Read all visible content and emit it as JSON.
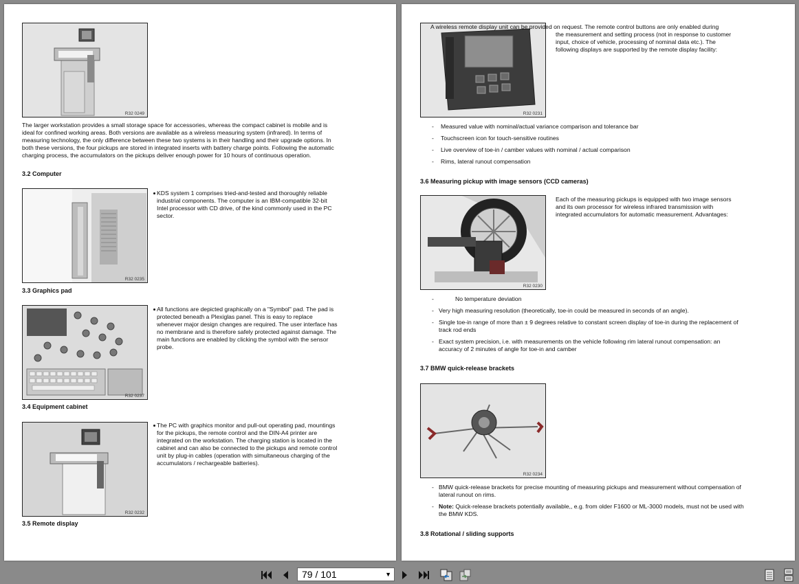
{
  "left": {
    "figures": [
      {
        "code": "R32 0249"
      },
      {
        "code": "R32 0235"
      },
      {
        "code": "R32 0237"
      },
      {
        "code": "R32 0232"
      }
    ],
    "intro_text": "The larger workstation provides a small storage space for accessories, whereas the compact cabinet is mobile and is ideal for confined working areas. Both versions are available as a wireless measuring system (infrared). In terms of measuring technology, the only difference between these two systems is in their handling and their upgrade options. In both these versions, the four pickups are stored in integrated inserts with battery charge points. Following the automatic charging process, the accumulators on the pickups deliver enough power for 10 hours of continuous operation.",
    "h_computer": "3.2 Computer",
    "computer_text": "KDS system 1 comprises tried-and-tested and thoroughly reliable industrial components. The computer is an IBM-compatible 32-bit Intel processor with CD drive, of the kind commonly used in the PC sector.",
    "h_graphics": "3.3 Graphics pad",
    "graphics_text": "All functions are depicted graphically on a \"Symbol\" pad. The pad is protected beneath a Plexiglas panel. This is easy to replace whenever major design changes are required. The user interface has no membrane and is therefore safely protected against damage. The main functions are enabled by clicking the symbol with the sensor probe.",
    "h_cabinet": "3.4 Equipment cabinet",
    "cabinet_text": "The PC with graphics monitor and pull-out operating pad, mountings for the pickups, the remote control and the DIN-A4 printer are integrated on the workstation. The charging station is located in the cabinet and can also be connected to the pickups and remote control unit by plug-in cables (operation with simultaneous charging of the accumulators / rechargeable batteries).",
    "h_remote": "3.5 Remote display"
  },
  "right": {
    "figures": [
      {
        "code": "R32 0231"
      },
      {
        "code": "R32 0230"
      },
      {
        "code": "R32 0234"
      }
    ],
    "remote_line1": "A wireless remote display unit can be provided on request. The remote control buttons are only enabled during",
    "remote_rest": "the measurement and setting process (not in response to customer input, choice of vehicle, processing of nominal data etc.). The following displays are supported by the remote display facility:",
    "remote_list": [
      "Measured value with nominal/actual variance comparison and tolerance bar",
      "Touchscreen icon for touch-sensitive routines",
      "Live overview of toe-in / camber values with nominal / actual comparison",
      "Rims, lateral runout compensation"
    ],
    "h_pickup": "3.6 Measuring pickup with image sensors (CCD cameras)",
    "pickup_text": "Each of the measuring pickups is equipped with two image sensors and its own processor for wireless infrared transmission with integrated accumulators for automatic measurement. Advantages:",
    "pickup_list": [
      "No temperature deviation",
      "Very high measuring resolution (theoretically, toe-in could be measured in seconds of an angle).",
      "Single toe-in range of more than ± 9 degrees relative to constant screen display of toe-in during the replacement of track rod ends",
      "Exact system precision, i.e. with measurements on the vehicle following rim lateral runout compensation: an accuracy of 2 minutes of angle for toe-in and camber"
    ],
    "h_brackets": "3.7 BMW quick-release brackets",
    "brackets_list": [
      "BMW quick-release brackets for precise mounting of measuring pickups and measurement without compensation of lateral runout on rims."
    ],
    "note_label": "Note:",
    "note_text": " Quick-release brackets potentially available,, e.g. from older F1600 or ML-3000 models, must not be used with the BMW KDS.",
    "h_supports": "3.8 Rotational / sliding supports"
  },
  "toolbar": {
    "page_display": "79 / 101",
    "icons": [
      "first-page-icon",
      "prev-page-icon",
      "next-page-icon",
      "last-page-icon",
      "go-back-view-icon",
      "go-forward-view-icon",
      "single-page-view-icon",
      "continuous-view-icon"
    ]
  }
}
